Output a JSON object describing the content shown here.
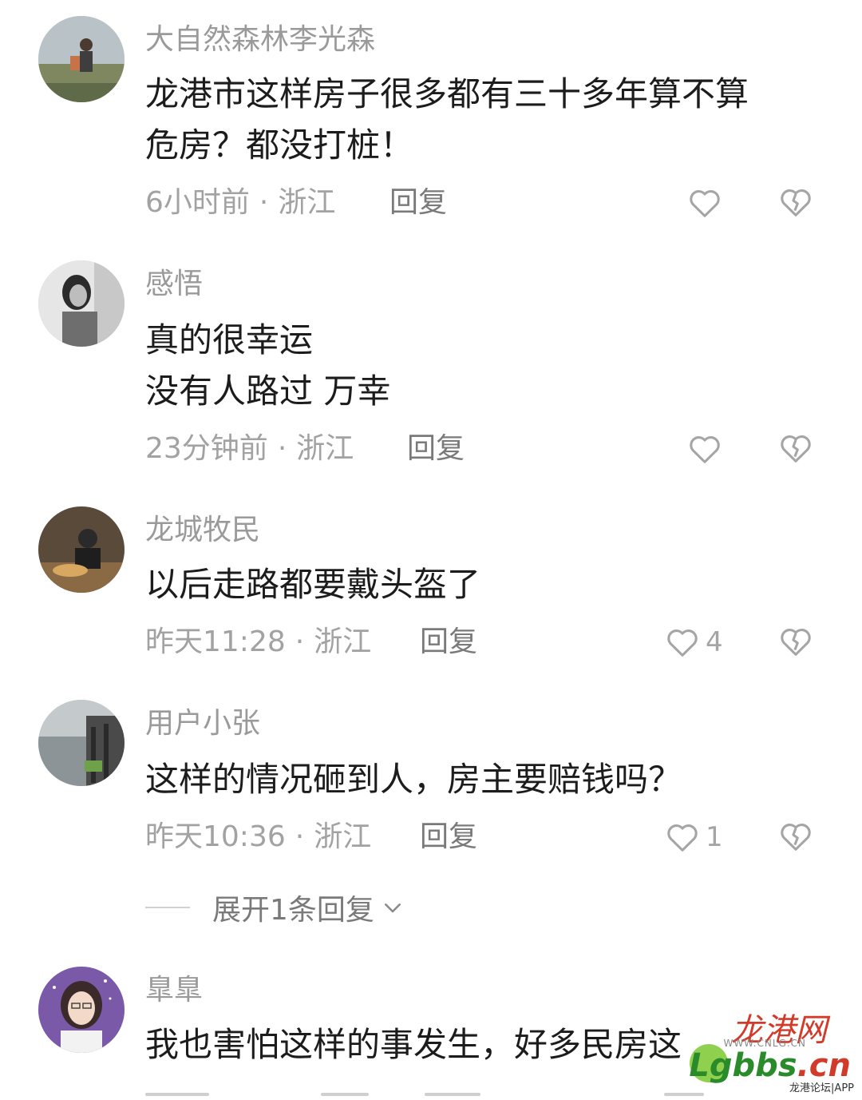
{
  "comments": [
    {
      "username": "大自然森林李光森",
      "lines": [
        "龙港市这样房子很多都有三十多年算不算",
        "危房？都没打桩！"
      ],
      "time": "6小时前",
      "location": "浙江",
      "reply_label": "回复",
      "like_count": ""
    },
    {
      "username": "感悟",
      "lines": [
        "真的很幸运",
        "没有人路过 万幸"
      ],
      "time": "23分钟前",
      "location": "浙江",
      "reply_label": "回复",
      "like_count": ""
    },
    {
      "username": "龙城牧民",
      "lines": [
        "以后走路都要戴头盔了"
      ],
      "time": "昨天11:28",
      "location": "浙江",
      "reply_label": "回复",
      "like_count": "4"
    },
    {
      "username": "用户小张",
      "lines": [
        "这样的情况砸到人，房主要赔钱吗？"
      ],
      "time": "昨天10:36",
      "location": "浙江",
      "reply_label": "回复",
      "like_count": "1"
    },
    {
      "username": "臯臯",
      "lines": [
        "我也害怕这样的事发生，好多民房这"
      ],
      "time": "",
      "location": "",
      "reply_label": "",
      "like_count": ""
    }
  ],
  "expand_replies": {
    "label": "展开1条回复"
  },
  "meta_separator": "·",
  "icons": {
    "like": "heart-outline-icon",
    "dislike": "broken-heart-icon",
    "expand": "chevron-down-icon"
  },
  "watermark": {
    "logo_text": "龙港网",
    "site_text": "WWW.CNLG.CN",
    "brand_text": "Lgbbs",
    "brand_suffix": ".cn",
    "sub_text": "龙港论坛|APP"
  },
  "colors": {
    "username": "#9a9a9a",
    "content": "#1c1c1c",
    "meta": "#a2a2a2",
    "icon": "#a5a5a5"
  }
}
